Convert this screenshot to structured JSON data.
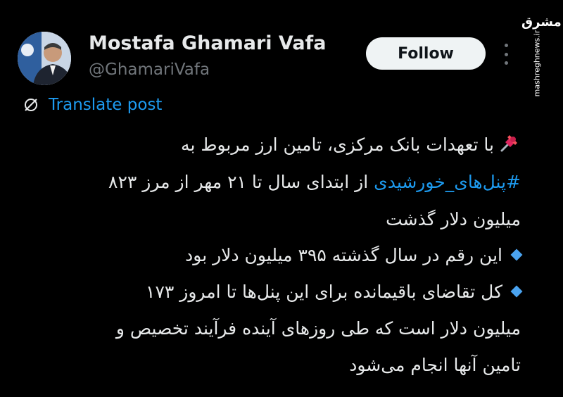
{
  "post": {
    "author_name": "Mostafa Ghamari Vafa",
    "author_handle": "@GhamariVafa",
    "follow_label": "Follow",
    "translate_label": "Translate post",
    "lines": {
      "l1": "با تعهدات بانک مرکزی، تامین ارز مربوط به",
      "l2_hashtag": "#پنل‌های_خورشیدی",
      "l2_rest": " از ابتدای سال تا ۲۱ مهر از مرز ۸۲۳",
      "l3": "میلیون دلار گذشت",
      "l4": "این رقم در سال گذشته ۳۹۵ میلیون دلار بود",
      "l5": "کل تقاضای باقیمانده برای این پنل‌ها تا امروز ۱۷۳",
      "l6": "میلیون دلار است که طی روزهای آینده فرآیند تخصیص و",
      "l7": "تامین آنها انجام می‌شود"
    }
  },
  "watermark": {
    "logo": "مشرق",
    "url": "mashreghnews.ir"
  },
  "icons": {
    "pin": "pushpin-icon",
    "bullet": "small-blue-diamond-icon",
    "translate": "translate-globe-icon",
    "more": "more-vertical-icon"
  },
  "colors": {
    "background": "#000000",
    "text": "#e7e9ea",
    "secondary": "#71767b",
    "link": "#1d9bf0",
    "follow_bg": "#eff3f4"
  }
}
